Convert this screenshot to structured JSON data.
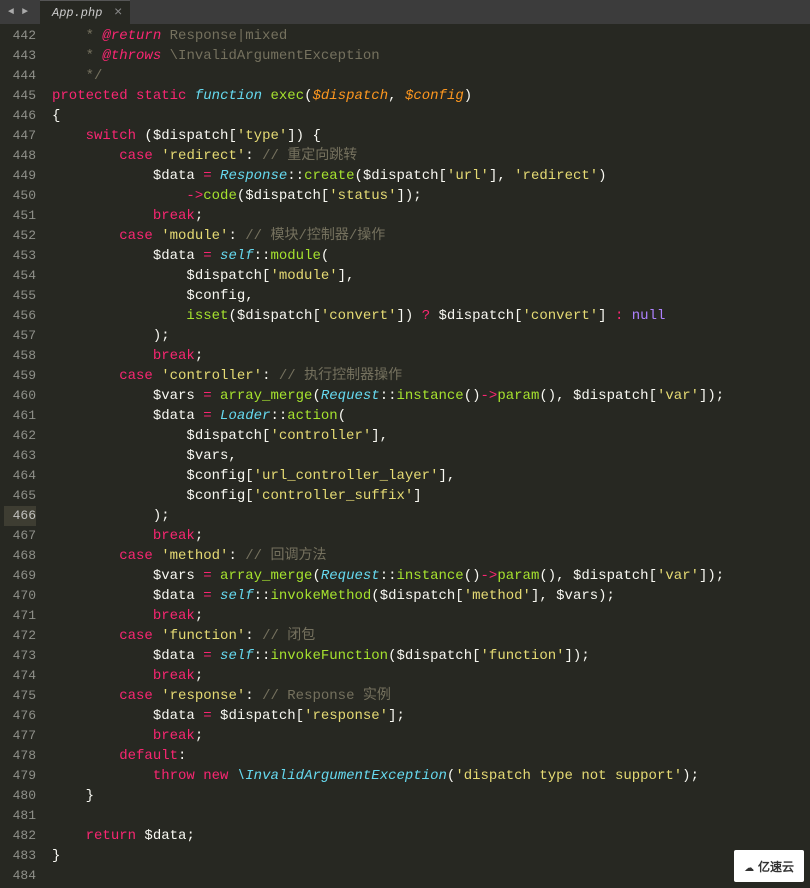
{
  "tab": {
    "filename": "App.php",
    "close": "×"
  },
  "nav": {
    "left": "◄",
    "right": "►"
  },
  "gutter": {
    "start": 442,
    "end": 484,
    "highlight": 466
  },
  "logo": {
    "text": "亿速云",
    "icon": "☁"
  },
  "code": {
    "l442": {
      "c1": "    * ",
      "tag": "@return",
      "c2": " Response|mixed"
    },
    "l443": {
      "c1": "    * ",
      "tag": "@throws",
      "c2": " \\InvalidArgumentException"
    },
    "l444": {
      "c1": "    */"
    },
    "l445": {
      "k1": "protected",
      "k2": "static",
      "k3": "function",
      "fn": "exec",
      "p1": "$dispatch",
      "p2": "$config"
    },
    "l446": {
      "b": "{"
    },
    "l447": {
      "k": "switch",
      "v": "$dispatch",
      "s": "'type'"
    },
    "l448": {
      "k": "case",
      "s": "'redirect'",
      "c": "// 重定向跳转"
    },
    "l449": {
      "v1": "$data",
      "cls": "Response",
      "fn": "create",
      "v2": "$dispatch",
      "s1": "'url'",
      "s2": "'redirect'"
    },
    "l450": {
      "fn": "code",
      "v": "$dispatch",
      "s": "'status'"
    },
    "l451": {
      "k": "break"
    },
    "l452": {
      "k": "case",
      "s": "'module'",
      "c": "// 模块/控制器/操作"
    },
    "l453": {
      "v": "$data",
      "cls": "self",
      "fn": "module"
    },
    "l454": {
      "v": "$dispatch",
      "s": "'module'"
    },
    "l455": {
      "v": "$config"
    },
    "l456": {
      "fn": "isset",
      "v1": "$dispatch",
      "s1": "'convert'",
      "v2": "$dispatch",
      "s2": "'convert'",
      "n": "null"
    },
    "l457": {
      "p": ");"
    },
    "l458": {
      "k": "break"
    },
    "l459": {
      "k": "case",
      "s": "'controller'",
      "c": "// 执行控制器操作"
    },
    "l460": {
      "v1": "$vars",
      "fn1": "array_merge",
      "cls": "Request",
      "fn2": "instance",
      "fn3": "param",
      "v2": "$dispatch",
      "s": "'var'"
    },
    "l461": {
      "v": "$data",
      "cls": "Loader",
      "fn": "action"
    },
    "l462": {
      "v": "$dispatch",
      "s": "'controller'"
    },
    "l463": {
      "v": "$vars"
    },
    "l464": {
      "v": "$config",
      "s": "'url_controller_layer'"
    },
    "l465": {
      "v": "$config",
      "s": "'controller_suffix'"
    },
    "l466": {
      "p": ");"
    },
    "l467": {
      "k": "break"
    },
    "l468": {
      "k": "case",
      "s": "'method'",
      "c": "// 回调方法"
    },
    "l469": {
      "v1": "$vars",
      "fn1": "array_merge",
      "cls": "Request",
      "fn2": "instance",
      "fn3": "param",
      "v2": "$dispatch",
      "s": "'var'"
    },
    "l470": {
      "v1": "$data",
      "cls": "self",
      "fn": "invokeMethod",
      "v2": "$dispatch",
      "s": "'method'",
      "v3": "$vars"
    },
    "l471": {
      "k": "break"
    },
    "l472": {
      "k": "case",
      "s": "'function'",
      "c": "// 闭包"
    },
    "l473": {
      "v1": "$data",
      "cls": "self",
      "fn": "invokeFunction",
      "v2": "$dispatch",
      "s": "'function'"
    },
    "l474": {
      "k": "break"
    },
    "l475": {
      "k": "case",
      "s": "'response'",
      "c": "// Response 实例"
    },
    "l476": {
      "v1": "$data",
      "v2": "$dispatch",
      "s": "'response'"
    },
    "l477": {
      "k": "break"
    },
    "l478": {
      "k": "default"
    },
    "l479": {
      "k1": "throw",
      "k2": "new",
      "cls": "\\InvalidArgumentException",
      "s": "'dispatch type not support'"
    },
    "l480": {
      "b": "}"
    },
    "l481": {
      "b": ""
    },
    "l482": {
      "k": "return",
      "v": "$data"
    },
    "l483": {
      "b": "}"
    },
    "l484": {
      "b": ""
    }
  }
}
